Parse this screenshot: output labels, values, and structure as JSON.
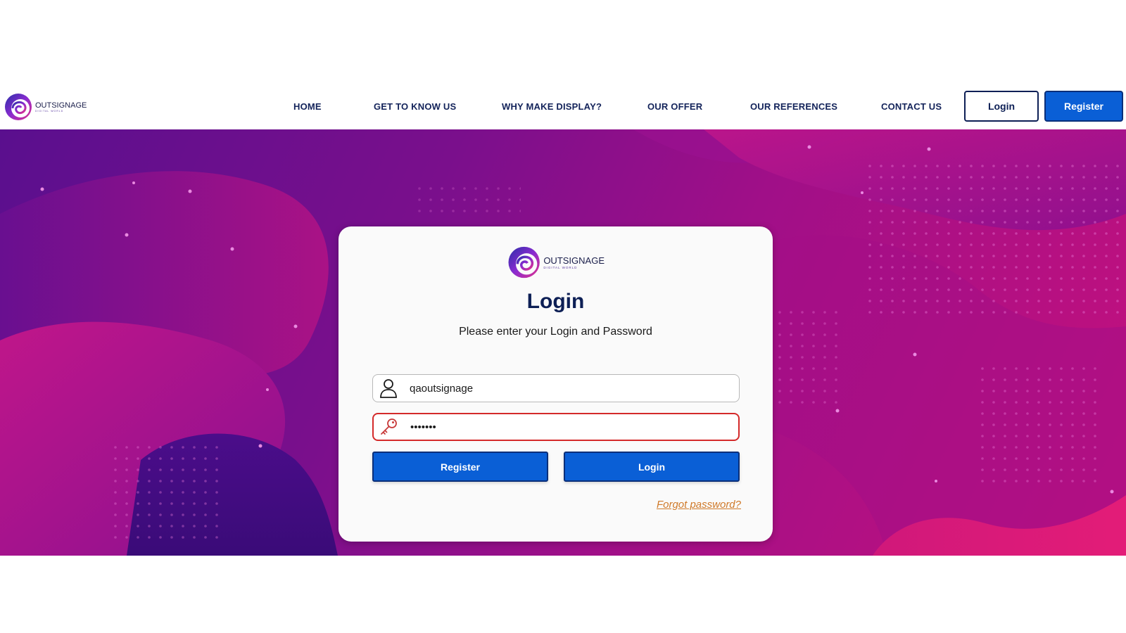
{
  "header": {
    "logo": {
      "name": "OUTSIGNAGE",
      "tagline": "DIGITAL WORLD",
      "icon": "swirl-logo-icon"
    },
    "nav": [
      {
        "label": "HOME"
      },
      {
        "label": "GET TO KNOW US"
      },
      {
        "label": "WHY MAKE DISPLAY?"
      },
      {
        "label": "OUR OFFER"
      },
      {
        "label": "OUR REFERENCES"
      },
      {
        "label": "CONTACT US"
      }
    ],
    "login_label": "Login",
    "register_label": "Register"
  },
  "login_card": {
    "logo": {
      "name": "OUTSIGNAGE",
      "tagline": "DIGITAL WORLD"
    },
    "title": "Login",
    "subtitle": "Please enter your Login and Password",
    "username": {
      "value": "qaoutsignage",
      "icon": "user-icon"
    },
    "password": {
      "value": "•••••••",
      "icon": "key-icon"
    },
    "register_label": "Register",
    "login_label": "Login",
    "forgot_label": "Forgot password?"
  },
  "colors": {
    "primary_button": "#0a5fd6",
    "nav_text": "#13235a",
    "error_border": "#d42a2a",
    "link": "#d07a2a",
    "hero_gradient_start": "#5a0f8e",
    "hero_gradient_end": "#c4117d"
  }
}
